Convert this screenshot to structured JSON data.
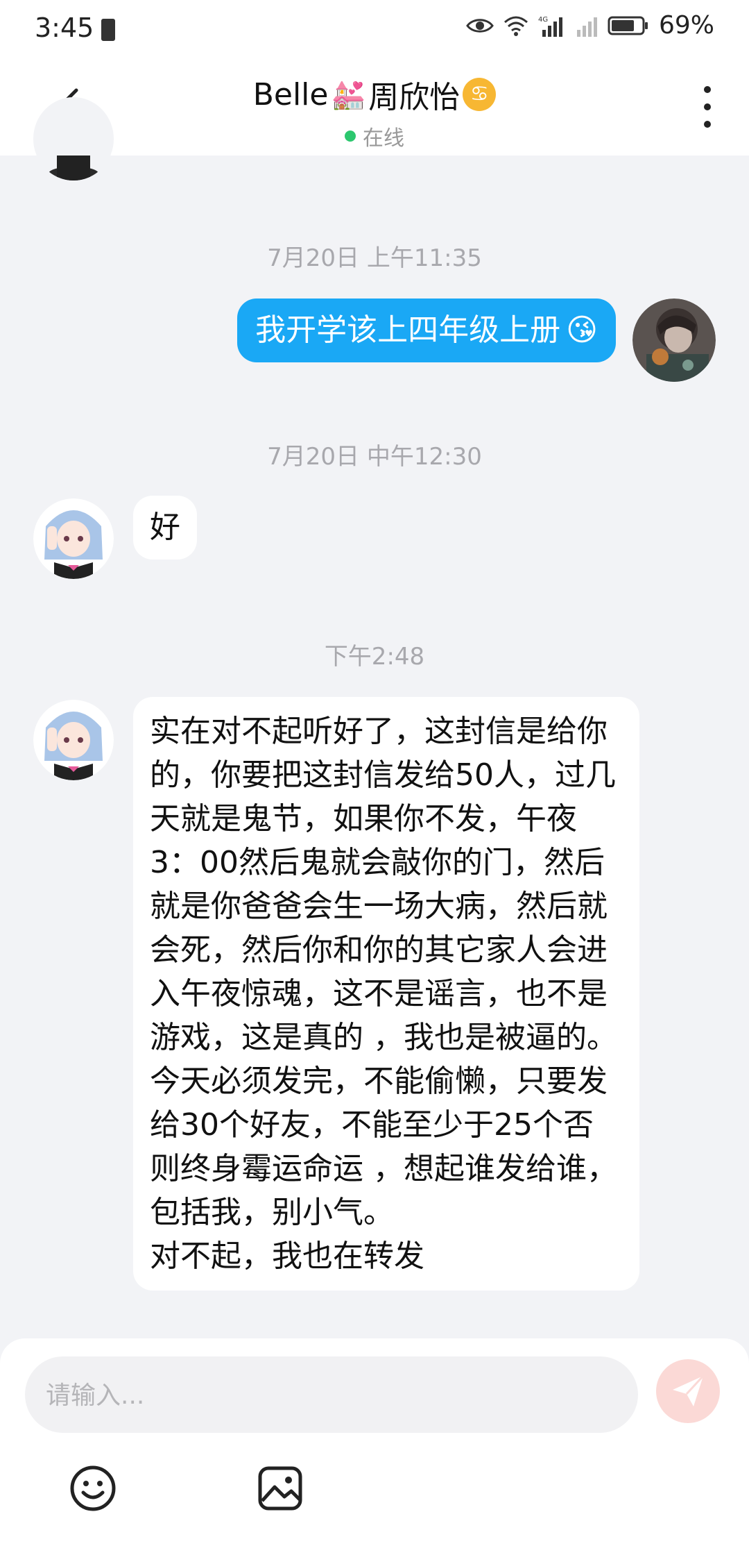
{
  "status_bar": {
    "time": "3:45",
    "battery_percent": "69%",
    "network": "4G"
  },
  "header": {
    "name_prefix": "Belle",
    "name_emoji": "💒",
    "name_suffix": "周欣怡",
    "zodiac_symbol": "♋",
    "status": "在线"
  },
  "messages": [
    {
      "type": "timestamp",
      "text": "7月20日 上午11:35"
    },
    {
      "type": "outgoing",
      "text": "我开学该上四年级上册",
      "emoji": "😘"
    },
    {
      "type": "timestamp",
      "text": "7月20日 中午12:30"
    },
    {
      "type": "incoming",
      "text": "好"
    },
    {
      "type": "timestamp",
      "text": "下午2:48"
    },
    {
      "type": "incoming",
      "text": "实在对不起听好了，这封信是给你的，你要把这封信发给50人，过几天就是鬼节，如果你不发，午夜3：00然后鬼就会敲你的门，然后就是你爸爸会生一场大病，然后就会死，然后你和你的其它家人会进入午夜惊魂，这不是谣言，也不是游戏，这是真的 ，我也是被逼的。\n今天必须发完，不能偷懒，只要发给30个好友，不能至少于25个否则终身霉运命运 ，想起谁发给谁，包括我，别小气。\n对不起，我也在转发"
    }
  ],
  "input": {
    "placeholder": "请输入..."
  },
  "colors": {
    "outgoing_bubble": "#1aa8f5",
    "online_dot": "#2cc76e",
    "send_button": "#fbd9d6",
    "background": "#f2f3f6"
  },
  "icons": {
    "back": "chevron-left-icon",
    "more": "more-vertical-icon",
    "send": "send-icon",
    "emoji": "smiley-icon",
    "image": "image-icon"
  }
}
